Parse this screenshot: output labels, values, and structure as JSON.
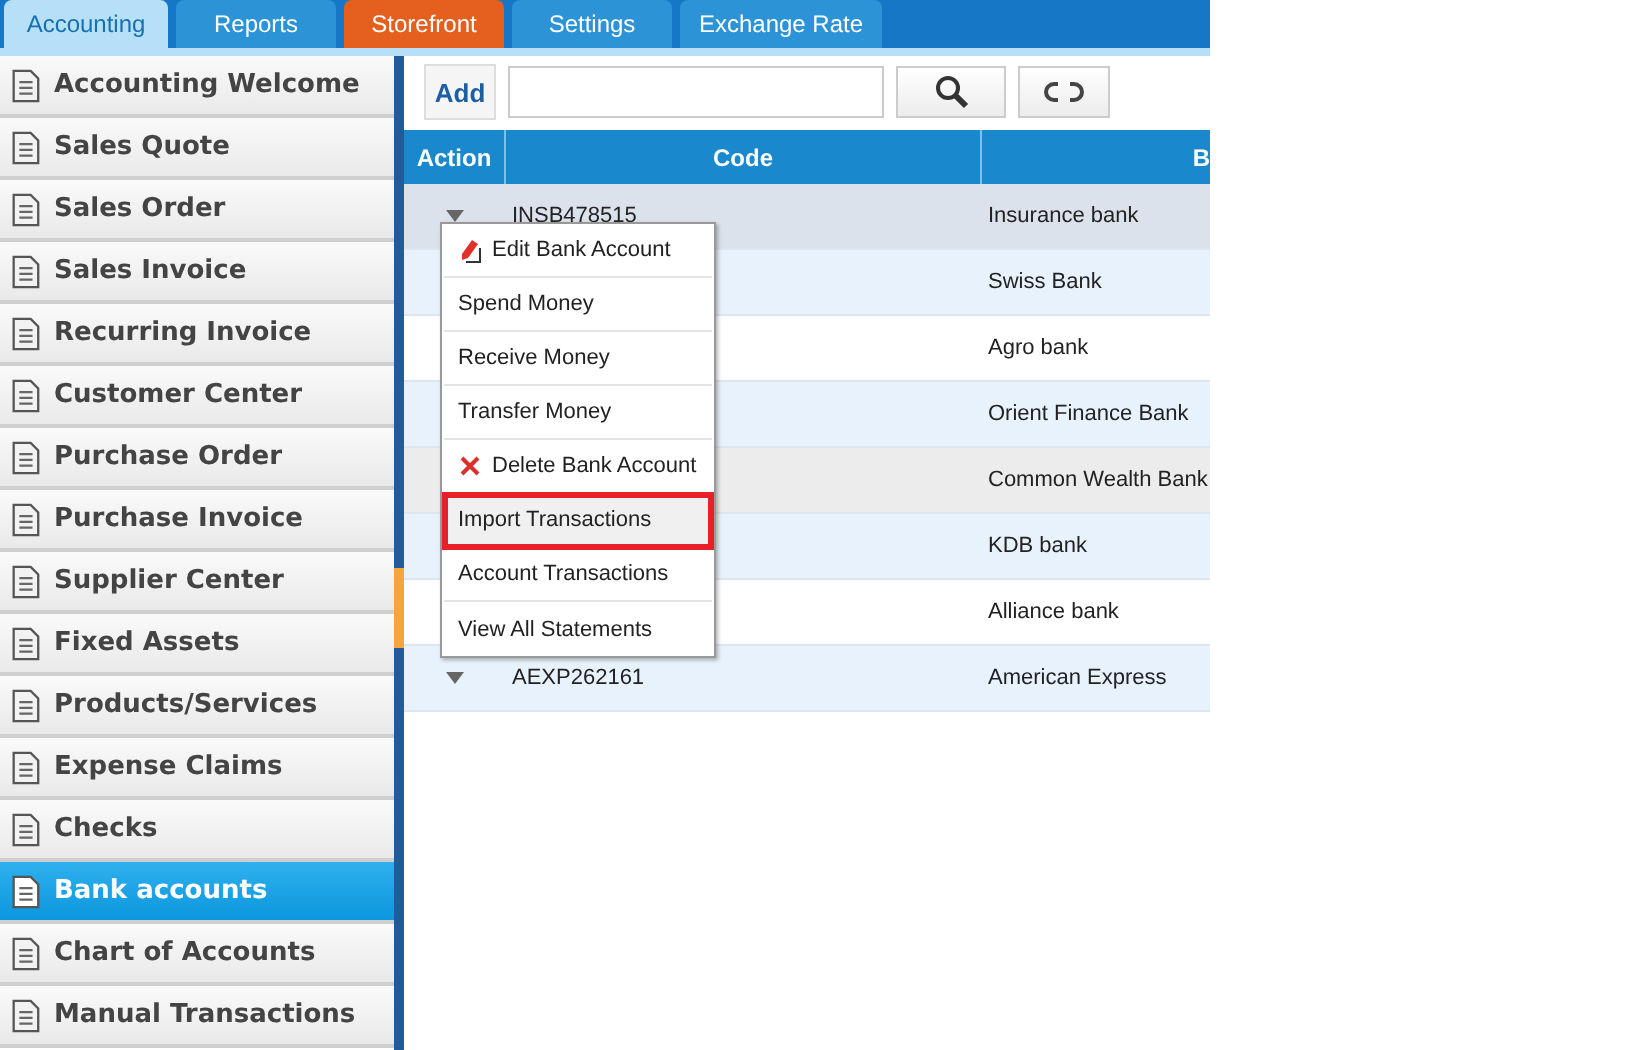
{
  "tabs": [
    {
      "label": "Accounting",
      "selected": true,
      "kind": "normal"
    },
    {
      "label": "Reports",
      "selected": false,
      "kind": "normal"
    },
    {
      "label": "Storefront",
      "selected": false,
      "kind": "accent"
    },
    {
      "label": "Settings",
      "selected": false,
      "kind": "normal"
    },
    {
      "label": "Exchange Rate",
      "selected": false,
      "kind": "normal"
    }
  ],
  "sidebar": {
    "items": [
      {
        "label": "Accounting Welcome",
        "selected": false
      },
      {
        "label": "Sales Quote",
        "selected": false
      },
      {
        "label": "Sales Order",
        "selected": false
      },
      {
        "label": "Sales Invoice",
        "selected": false
      },
      {
        "label": "Recurring Invoice",
        "selected": false
      },
      {
        "label": "Customer Center",
        "selected": false
      },
      {
        "label": "Purchase Order",
        "selected": false
      },
      {
        "label": "Purchase Invoice",
        "selected": false
      },
      {
        "label": "Supplier Center",
        "selected": false
      },
      {
        "label": "Fixed Assets",
        "selected": false
      },
      {
        "label": "Products/Services",
        "selected": false
      },
      {
        "label": "Expense Claims",
        "selected": false
      },
      {
        "label": "Checks",
        "selected": false
      },
      {
        "label": "Bank accounts",
        "selected": true
      },
      {
        "label": "Chart of Accounts",
        "selected": false
      },
      {
        "label": "Manual Transactions",
        "selected": false
      }
    ]
  },
  "toolbar": {
    "add_label": "Add"
  },
  "table": {
    "columns": [
      "Action",
      "Code",
      "B"
    ],
    "rows": [
      {
        "code": "INSB478515",
        "bank": "Insurance bank",
        "hovered": true,
        "selected": false
      },
      {
        "bank": "Swiss Bank",
        "hovered": false,
        "selected": false
      },
      {
        "bank": "Agro bank",
        "hovered": false,
        "selected": false
      },
      {
        "bank": "Orient Finance Bank",
        "hovered": false,
        "selected": false
      },
      {
        "bank": "Common Wealth Bank",
        "hovered": false,
        "selected": true
      },
      {
        "bank": "KDB bank",
        "hovered": false,
        "selected": false
      },
      {
        "bank": "Alliance bank",
        "hovered": false,
        "selected": false
      },
      {
        "code": "AEXP262161",
        "bank": "American Express",
        "hovered": false,
        "selected": false
      }
    ]
  },
  "context_menu": {
    "items": [
      {
        "label": "Edit Bank Account",
        "kind": "edit",
        "highlighted": false
      },
      {
        "label": "Spend Money",
        "kind": "plain",
        "highlighted": false
      },
      {
        "label": "Receive Money",
        "kind": "plain",
        "highlighted": false
      },
      {
        "label": "Transfer Money",
        "kind": "plain",
        "highlighted": false
      },
      {
        "label": "Delete Bank Account",
        "kind": "delete",
        "highlighted": false
      },
      {
        "label": "Import Transactions",
        "kind": "plain",
        "highlighted": true
      },
      {
        "label": "Account Transactions",
        "kind": "plain",
        "highlighted": false
      },
      {
        "label": "View All Statements",
        "kind": "plain",
        "highlighted": false
      }
    ]
  }
}
